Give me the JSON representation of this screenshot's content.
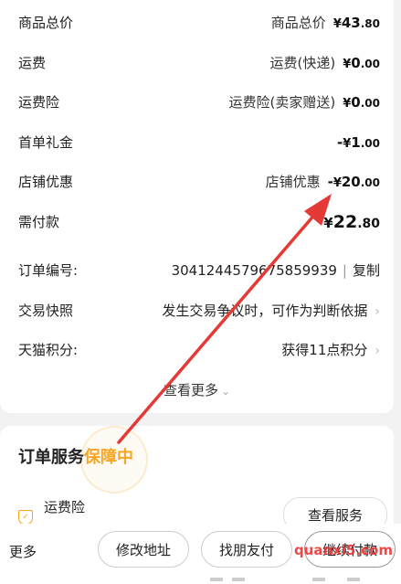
{
  "fees": [
    {
      "label": "商品总价",
      "sub": "商品总价",
      "prefix": "",
      "yen": "¥",
      "int": "43",
      "dec": ".80",
      "chevron": ""
    },
    {
      "label": "运费",
      "sub": "运费(快递)",
      "prefix": "",
      "yen": "¥",
      "int": "0",
      "dec": ".00",
      "chevron": ""
    },
    {
      "label": "运费险",
      "sub": "运费险(卖家赠送)",
      "prefix": "",
      "yen": "¥",
      "int": "0",
      "dec": ".00",
      "chevron": ""
    },
    {
      "label": "首单礼金",
      "sub": "",
      "prefix": "-",
      "yen": "¥",
      "int": "1",
      "dec": ".00",
      "chevron": ""
    },
    {
      "label": "店铺优惠",
      "sub": "店铺优惠",
      "prefix": "-",
      "yen": "¥",
      "int": "20",
      "dec": ".00",
      "chevron": ""
    }
  ],
  "total": {
    "label": "需付款",
    "yen": "¥",
    "int": "22",
    "dec": ".80"
  },
  "order_no": {
    "label": "订单编号:",
    "value": "3041244579675859939",
    "sep": "|",
    "copy": "复制"
  },
  "snapshot": {
    "label": "交易快照",
    "value": "发生交易争议时，可作为判断依据",
    "chevron": "›"
  },
  "points": {
    "label": "天猫积分:",
    "value": "获得11点积分",
    "chevron": "›"
  },
  "view_more": {
    "label": "查看更多",
    "chevron": "⌄"
  },
  "service": {
    "title": "订单服务",
    "status": "保障中",
    "insurance_label": "运费险",
    "view_btn": "查看服务"
  },
  "bottom_bar": {
    "more": "更多",
    "modify_address": "修改地址",
    "friend_pay": "找朋友付",
    "pay": "继续付款"
  },
  "watermark": "quanxi5.com",
  "colors": {
    "accent": "#f5a623",
    "arrow": "#e53935"
  }
}
